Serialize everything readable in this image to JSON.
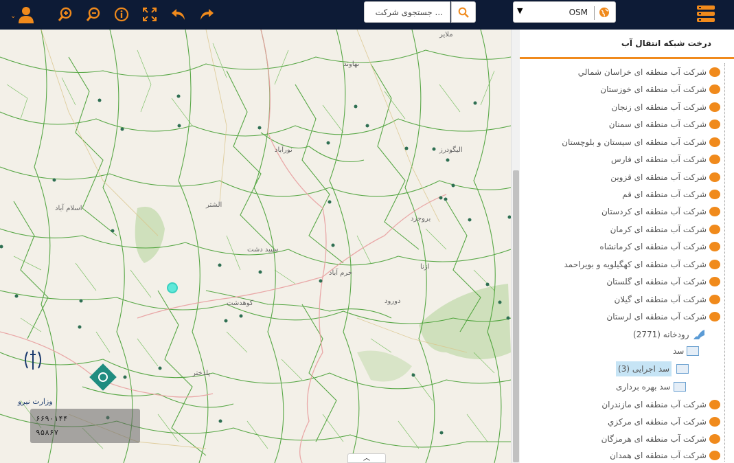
{
  "toolbar": {
    "search_placeholder": "جستجوی شرکت ...",
    "layer_value": "OSM",
    "icons": [
      "user-icon",
      "zoom-in-icon",
      "zoom-out-icon",
      "info-icon",
      "fullscreen-icon",
      "undo-icon",
      "redo-icon",
      "search-icon",
      "globe-icon",
      "menu-icon"
    ],
    "accent_color": "#f08a1c",
    "bar_color": "#0d1b36"
  },
  "panel": {
    "title": "درخت شبکه انتقال آب",
    "items": [
      "شرکت آب منطقه ای خراسان شمالي",
      "شرکت آب منطقه ای خوزستان",
      "شرکت آب منطقه ای زنجان",
      "شرکت آب منطقه ای سمنان",
      "شرکت آب منطقه ای سیستان و بلوچستان",
      "شرکت آب منطقه ای فارس",
      "شرکت آب منطقه ای قزوین",
      "شرکت آب منطقه ای قم",
      "شرکت آب منطقه ای کردستان",
      "شرکت آب منطقه ای کرمان",
      "شرکت آب منطقه ای کرمانشاه",
      "شرکت آب منطقه ای کهگیلویه و بویراحمد",
      "شرکت آب منطقه ای گلستان",
      "شرکت آب منطقه ای گیلان",
      "شرکت آب منطقه ای لرستان"
    ],
    "lorestan_children": {
      "river": "رودخانه (2771)",
      "dam": "سد",
      "dam_children": [
        "سد اجرایی (3)",
        "سد بهره برداری"
      ]
    },
    "items_after": [
      "شرکت آب منطقه ای مازندران",
      "شرکت آب منطقه ای مرکزي",
      "شرکت آب منطقه ای هرمزگان",
      "شرکت آب منطقه ای همدان"
    ]
  },
  "map": {
    "coord_x": "۶۶۹۰۱۴۴",
    "coord_y": "۹۵۸۶۷",
    "place_labels": [
      "خرم آباد",
      "بروجرد",
      "الیگودرز",
      "ازنا",
      "نورآباد",
      "کوهدشت",
      "پلدختر",
      "سپید دشت",
      "الشتر",
      "دورود",
      "ملایر",
      "نهاوند",
      "اسلام آباد"
    ]
  }
}
